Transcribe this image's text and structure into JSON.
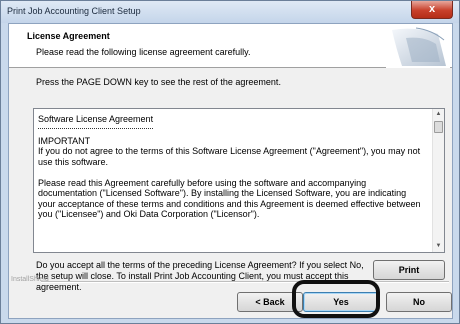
{
  "window": {
    "title": "Print Job Accounting Client Setup",
    "close_glyph": "x"
  },
  "header": {
    "title": "License Agreement",
    "subtitle": "Please read the following license agreement carefully."
  },
  "instruction": "Press the PAGE DOWN key to see the rest of the agreement.",
  "license": {
    "paragraphs": [
      "Software License Agreement",
      "IMPORTANT\nIf you do not agree to the terms of this Software License Agreement (\"Agreement\"), you may not use this software.",
      "Please read this Agreement carefully before using the software and accompanying documentation (\"Licensed Software\"). By installing the Licensed Software, you are indicating your acceptance of these terms and conditions and this Agreement is deemed effective between you (\"Licensee\") and Oki Data Corporation (\"Licensor\")."
    ]
  },
  "question": "Do you accept all the terms of the preceding License Agreement? If you select No, the setup will close. To install Print Job Accounting Client, you must accept this agreement.",
  "buttons": {
    "print": "Print",
    "back": "< Back",
    "yes": "Yes",
    "no": "No"
  },
  "installshield_label": "InstallShield",
  "colors": {
    "title_bar": "#c4d5ea",
    "close_button": "#c8402b",
    "dialog_background": "#f0f0f0",
    "highlight_ring": "#111111"
  },
  "icons": {
    "close": "close-icon",
    "scroll_up": "scroll-up-arrow-icon",
    "scroll_down": "scroll-down-arrow-icon",
    "header_graphic": "setup-graphic-icon"
  }
}
